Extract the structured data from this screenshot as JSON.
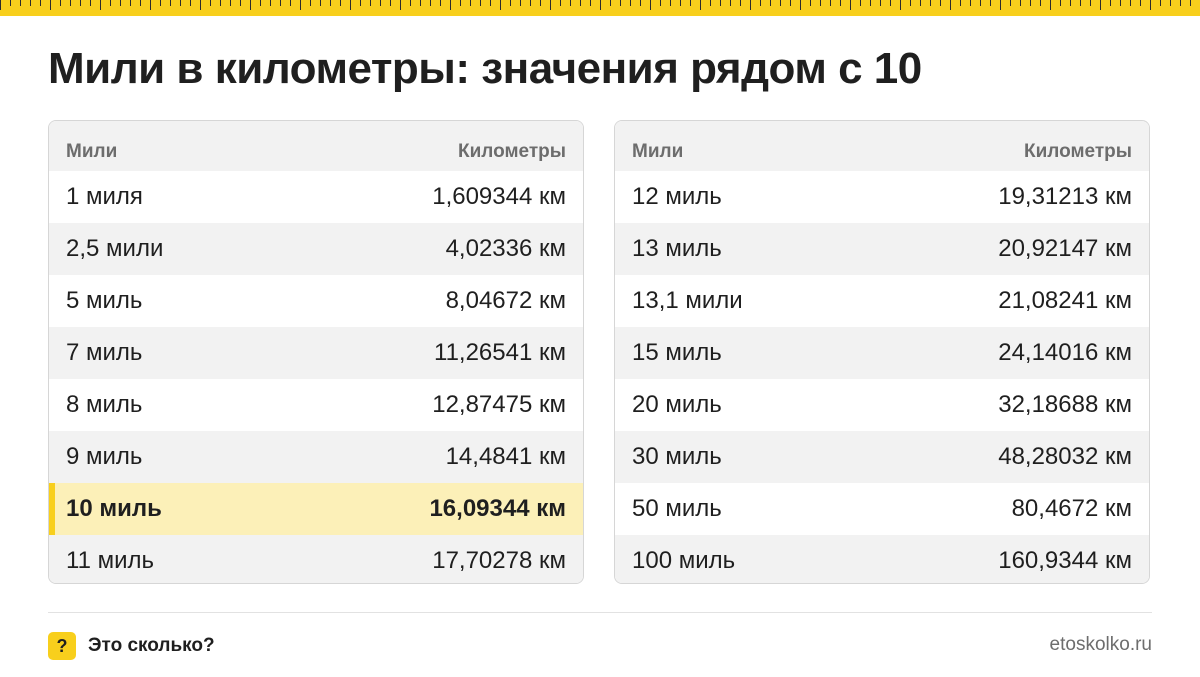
{
  "title": "Мили в километры: значения рядом с 10",
  "tables": [
    {
      "headers": [
        "Мили",
        "Километры"
      ],
      "rows": [
        [
          "1 миля",
          "1,609344 км"
        ],
        [
          "2,5 мили",
          "4,02336 км"
        ],
        [
          "5 миль",
          "8,04672 км"
        ],
        [
          "7 миль",
          "11,26541 км"
        ],
        [
          "8 миль",
          "12,87475 км"
        ],
        [
          "9 миль",
          "14,4841 км"
        ],
        [
          "10 миль",
          "16,09344 км"
        ],
        [
          "11 миль",
          "17,70278 км"
        ]
      ],
      "highlighted_row": 6
    },
    {
      "headers": [
        "Мили",
        "Километры"
      ],
      "rows": [
        [
          "12 миль",
          "19,31213 км"
        ],
        [
          "13 миль",
          "20,92147 км"
        ],
        [
          "13,1 мили",
          "21,08241 км"
        ],
        [
          "15 миль",
          "24,14016 км"
        ],
        [
          "20 миль",
          "32,18688 км"
        ],
        [
          "30 миль",
          "48,28032 км"
        ],
        [
          "50 миль",
          "80,4672 км"
        ],
        [
          "100 миль",
          "160,9344 км"
        ]
      ]
    }
  ],
  "footer": {
    "logo_glyph": "?",
    "brand": "Это сколько?",
    "site": "etoskolko.ru"
  },
  "colors": {
    "accent": "#f8cf1c",
    "highlight_bg": "#fcf0b8",
    "stripe_bg": "#f2f2f2"
  }
}
